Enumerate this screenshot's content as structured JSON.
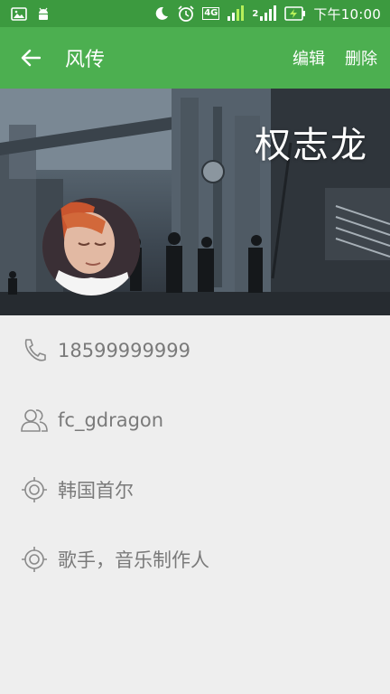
{
  "statusbar": {
    "time": "下午10:00",
    "network_label": "4G",
    "sim_label": "2"
  },
  "appbar": {
    "title": "风传",
    "edit_label": "编辑",
    "delete_label": "删除"
  },
  "profile": {
    "name": "权志龙"
  },
  "details": [
    {
      "icon": "phone-icon",
      "text": "18599999999"
    },
    {
      "icon": "contacts-icon",
      "text": "fc_gdragon"
    },
    {
      "icon": "location-icon",
      "text": "韩国首尔"
    },
    {
      "icon": "location-icon",
      "text": "歌手，音乐制作人"
    }
  ],
  "colors": {
    "statusbar": "#3c9a3f",
    "appbar": "#4caf50",
    "background": "#eeeeee",
    "detail_text": "#7a7a7a"
  }
}
